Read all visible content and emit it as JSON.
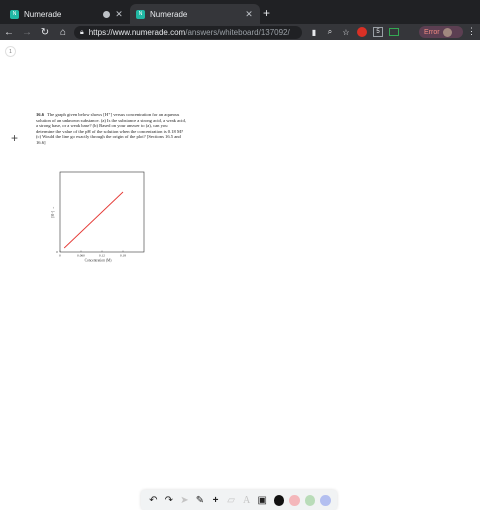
{
  "browser": {
    "tabs": [
      {
        "title": "Numerade",
        "active": false
      },
      {
        "title": "Numerade",
        "active": true
      }
    ],
    "new_tab_glyph": "+",
    "url_host": "https://www.numerade.com",
    "url_path": "/answers/whiteboard/137092/",
    "extension_badge": "5",
    "error_label": "Error"
  },
  "page": {
    "page_number": "1",
    "question": {
      "number": "16.6",
      "text": "The graph given below shows [H⁺] versus concentration for an aqueous solution of an unknown substance. (a) Is the substance a strong acid, a weak acid, a strong base, or a weak base? (b) Based on your answer to (a), can you determine the value of the pH of the solution when the concentration is 0.18 M? (c) Would the line go exactly through the origin of the plot? [Sections 16.5 and 16.6]"
    }
  },
  "chart_data": {
    "type": "line",
    "xlabel": "Concentration (M)",
    "ylabel": "[H⁺] →",
    "x_ticks": [
      "0",
      "0.060",
      "0.12",
      "0.18"
    ],
    "y_ticks": [
      "0"
    ],
    "series": [
      {
        "x": [
          0.012,
          0.18
        ],
        "y": [
          0.012,
          0.18
        ],
        "color": "#e53935"
      }
    ],
    "xlim": [
      0,
      0.24
    ],
    "ylim": [
      0,
      0.24
    ],
    "grid": false
  },
  "drawing_toolbar": {
    "colors": [
      "#111111",
      "#f4b7bb",
      "#b9dcb9",
      "#b3bff0"
    ]
  }
}
